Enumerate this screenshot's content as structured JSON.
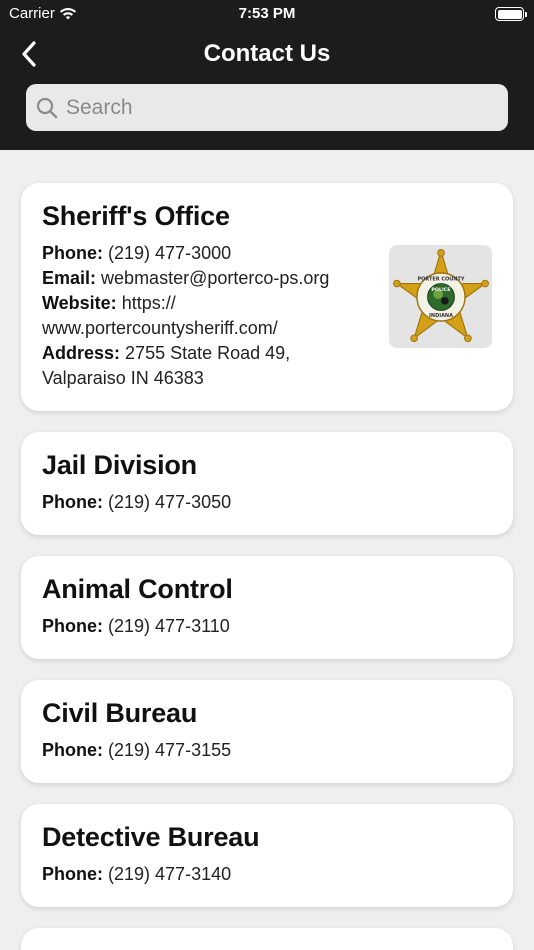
{
  "status_bar": {
    "carrier": "Carrier",
    "time": "7:53 PM"
  },
  "nav": {
    "title": "Contact Us"
  },
  "search": {
    "placeholder": "Search"
  },
  "labels": {
    "phone": "Phone:",
    "email": "Email:",
    "website": "Website:",
    "address": "Address:"
  },
  "contacts": [
    {
      "name": "Sheriff's Office",
      "phone": "(219) 477-3000",
      "email": "webmaster@porterco-ps.org",
      "website": "https://www.portercountysheriff.com/",
      "website_line1": "https://",
      "website_line2": "www.portercountysheriff.com/",
      "address_line1": "2755 State Road 49,",
      "address_line2": "Valparaiso IN 46383",
      "logo_text_top": "PORTER COUNTY",
      "logo_text_center": "POLICE",
      "logo_text_bottom": "INDIANA"
    },
    {
      "name": "Jail Division",
      "phone": "(219) 477-3050"
    },
    {
      "name": "Animal Control",
      "phone": "(219) 477-3110"
    },
    {
      "name": "Civil Bureau",
      "phone": "(219) 477-3155"
    },
    {
      "name": "Detective Bureau",
      "phone": "(219) 477-3140"
    }
  ],
  "colors": {
    "header": "#1c1c1c",
    "background": "#efefef",
    "card": "#ffffff",
    "badge_gold": "#d4a017"
  }
}
